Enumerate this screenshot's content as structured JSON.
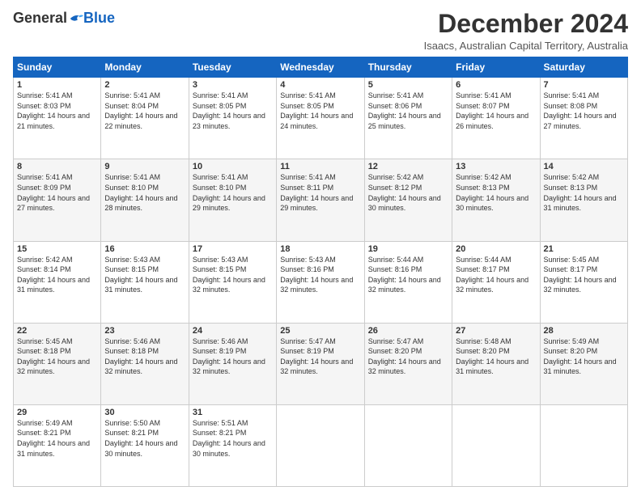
{
  "logo": {
    "general": "General",
    "blue": "Blue"
  },
  "header": {
    "title": "December 2024",
    "subtitle": "Isaacs, Australian Capital Territory, Australia"
  },
  "calendar": {
    "days_of_week": [
      "Sunday",
      "Monday",
      "Tuesday",
      "Wednesday",
      "Thursday",
      "Friday",
      "Saturday"
    ],
    "weeks": [
      [
        {
          "day": "1",
          "sunrise": "Sunrise: 5:41 AM",
          "sunset": "Sunset: 8:03 PM",
          "daylight": "Daylight: 14 hours and 21 minutes."
        },
        {
          "day": "2",
          "sunrise": "Sunrise: 5:41 AM",
          "sunset": "Sunset: 8:04 PM",
          "daylight": "Daylight: 14 hours and 22 minutes."
        },
        {
          "day": "3",
          "sunrise": "Sunrise: 5:41 AM",
          "sunset": "Sunset: 8:05 PM",
          "daylight": "Daylight: 14 hours and 23 minutes."
        },
        {
          "day": "4",
          "sunrise": "Sunrise: 5:41 AM",
          "sunset": "Sunset: 8:05 PM",
          "daylight": "Daylight: 14 hours and 24 minutes."
        },
        {
          "day": "5",
          "sunrise": "Sunrise: 5:41 AM",
          "sunset": "Sunset: 8:06 PM",
          "daylight": "Daylight: 14 hours and 25 minutes."
        },
        {
          "day": "6",
          "sunrise": "Sunrise: 5:41 AM",
          "sunset": "Sunset: 8:07 PM",
          "daylight": "Daylight: 14 hours and 26 minutes."
        },
        {
          "day": "7",
          "sunrise": "Sunrise: 5:41 AM",
          "sunset": "Sunset: 8:08 PM",
          "daylight": "Daylight: 14 hours and 27 minutes."
        }
      ],
      [
        {
          "day": "8",
          "sunrise": "Sunrise: 5:41 AM",
          "sunset": "Sunset: 8:09 PM",
          "daylight": "Daylight: 14 hours and 27 minutes."
        },
        {
          "day": "9",
          "sunrise": "Sunrise: 5:41 AM",
          "sunset": "Sunset: 8:10 PM",
          "daylight": "Daylight: 14 hours and 28 minutes."
        },
        {
          "day": "10",
          "sunrise": "Sunrise: 5:41 AM",
          "sunset": "Sunset: 8:10 PM",
          "daylight": "Daylight: 14 hours and 29 minutes."
        },
        {
          "day": "11",
          "sunrise": "Sunrise: 5:41 AM",
          "sunset": "Sunset: 8:11 PM",
          "daylight": "Daylight: 14 hours and 29 minutes."
        },
        {
          "day": "12",
          "sunrise": "Sunrise: 5:42 AM",
          "sunset": "Sunset: 8:12 PM",
          "daylight": "Daylight: 14 hours and 30 minutes."
        },
        {
          "day": "13",
          "sunrise": "Sunrise: 5:42 AM",
          "sunset": "Sunset: 8:13 PM",
          "daylight": "Daylight: 14 hours and 30 minutes."
        },
        {
          "day": "14",
          "sunrise": "Sunrise: 5:42 AM",
          "sunset": "Sunset: 8:13 PM",
          "daylight": "Daylight: 14 hours and 31 minutes."
        }
      ],
      [
        {
          "day": "15",
          "sunrise": "Sunrise: 5:42 AM",
          "sunset": "Sunset: 8:14 PM",
          "daylight": "Daylight: 14 hours and 31 minutes."
        },
        {
          "day": "16",
          "sunrise": "Sunrise: 5:43 AM",
          "sunset": "Sunset: 8:15 PM",
          "daylight": "Daylight: 14 hours and 31 minutes."
        },
        {
          "day": "17",
          "sunrise": "Sunrise: 5:43 AM",
          "sunset": "Sunset: 8:15 PM",
          "daylight": "Daylight: 14 hours and 32 minutes."
        },
        {
          "day": "18",
          "sunrise": "Sunrise: 5:43 AM",
          "sunset": "Sunset: 8:16 PM",
          "daylight": "Daylight: 14 hours and 32 minutes."
        },
        {
          "day": "19",
          "sunrise": "Sunrise: 5:44 AM",
          "sunset": "Sunset: 8:16 PM",
          "daylight": "Daylight: 14 hours and 32 minutes."
        },
        {
          "day": "20",
          "sunrise": "Sunrise: 5:44 AM",
          "sunset": "Sunset: 8:17 PM",
          "daylight": "Daylight: 14 hours and 32 minutes."
        },
        {
          "day": "21",
          "sunrise": "Sunrise: 5:45 AM",
          "sunset": "Sunset: 8:17 PM",
          "daylight": "Daylight: 14 hours and 32 minutes."
        }
      ],
      [
        {
          "day": "22",
          "sunrise": "Sunrise: 5:45 AM",
          "sunset": "Sunset: 8:18 PM",
          "daylight": "Daylight: 14 hours and 32 minutes."
        },
        {
          "day": "23",
          "sunrise": "Sunrise: 5:46 AM",
          "sunset": "Sunset: 8:18 PM",
          "daylight": "Daylight: 14 hours and 32 minutes."
        },
        {
          "day": "24",
          "sunrise": "Sunrise: 5:46 AM",
          "sunset": "Sunset: 8:19 PM",
          "daylight": "Daylight: 14 hours and 32 minutes."
        },
        {
          "day": "25",
          "sunrise": "Sunrise: 5:47 AM",
          "sunset": "Sunset: 8:19 PM",
          "daylight": "Daylight: 14 hours and 32 minutes."
        },
        {
          "day": "26",
          "sunrise": "Sunrise: 5:47 AM",
          "sunset": "Sunset: 8:20 PM",
          "daylight": "Daylight: 14 hours and 32 minutes."
        },
        {
          "day": "27",
          "sunrise": "Sunrise: 5:48 AM",
          "sunset": "Sunset: 8:20 PM",
          "daylight": "Daylight: 14 hours and 31 minutes."
        },
        {
          "day": "28",
          "sunrise": "Sunrise: 5:49 AM",
          "sunset": "Sunset: 8:20 PM",
          "daylight": "Daylight: 14 hours and 31 minutes."
        }
      ],
      [
        {
          "day": "29",
          "sunrise": "Sunrise: 5:49 AM",
          "sunset": "Sunset: 8:21 PM",
          "daylight": "Daylight: 14 hours and 31 minutes."
        },
        {
          "day": "30",
          "sunrise": "Sunrise: 5:50 AM",
          "sunset": "Sunset: 8:21 PM",
          "daylight": "Daylight: 14 hours and 30 minutes."
        },
        {
          "day": "31",
          "sunrise": "Sunrise: 5:51 AM",
          "sunset": "Sunset: 8:21 PM",
          "daylight": "Daylight: 14 hours and 30 minutes."
        },
        null,
        null,
        null,
        null
      ]
    ]
  }
}
